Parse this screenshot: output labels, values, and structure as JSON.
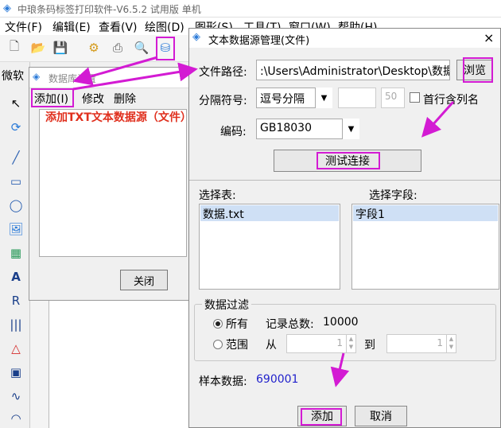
{
  "app": {
    "title": "中琅条码标签打印软件-V6.5.2 试用版 单机",
    "menu": [
      "文件(F)",
      "编辑(E)",
      "查看(V)",
      "绘图(D)",
      "图形(S)",
      "工具(T)",
      "窗口(W)",
      "帮助(H)"
    ],
    "font_label": "微软"
  },
  "ds_dialog": {
    "title": "数据库设置",
    "menu": {
      "add": "添加(I)",
      "edit": "修改",
      "delete": "删除"
    },
    "note": "添加TXT文本数据源（文件）",
    "close": "关闭"
  },
  "tds": {
    "title": "文本数据源管理(文件)",
    "close_icon": "×",
    "path_label": "文件路径:",
    "path_value": ":\\Users\\Administrator\\Desktop\\数据.txt",
    "browse": "浏览",
    "sep_label": "分隔符号:",
    "sep_value": "逗号分隔",
    "sep_num": "50",
    "first_row_label": "首行含列名",
    "encoding_label": "编码:",
    "encoding_value": "GB18030",
    "test_button": "测试连接",
    "select_table_label": "选择表:",
    "select_field_label": "选择字段:",
    "table_item": "数据.txt",
    "field_item": "字段1",
    "filter": {
      "legend": "数据过滤",
      "all_label": "所有",
      "total_label": "记录总数:",
      "total_value": "10000",
      "range_label": "范围",
      "from_label": "从",
      "from_value": "1",
      "to_label": "到",
      "to_value": "1"
    },
    "sample_label": "样本数据:",
    "sample_value": "690001",
    "add_button": "添加",
    "cancel_button": "取消"
  },
  "colors": {
    "highlight": "#d31bd3",
    "note_red": "#e0301e",
    "sample_blue": "#2222cc"
  }
}
